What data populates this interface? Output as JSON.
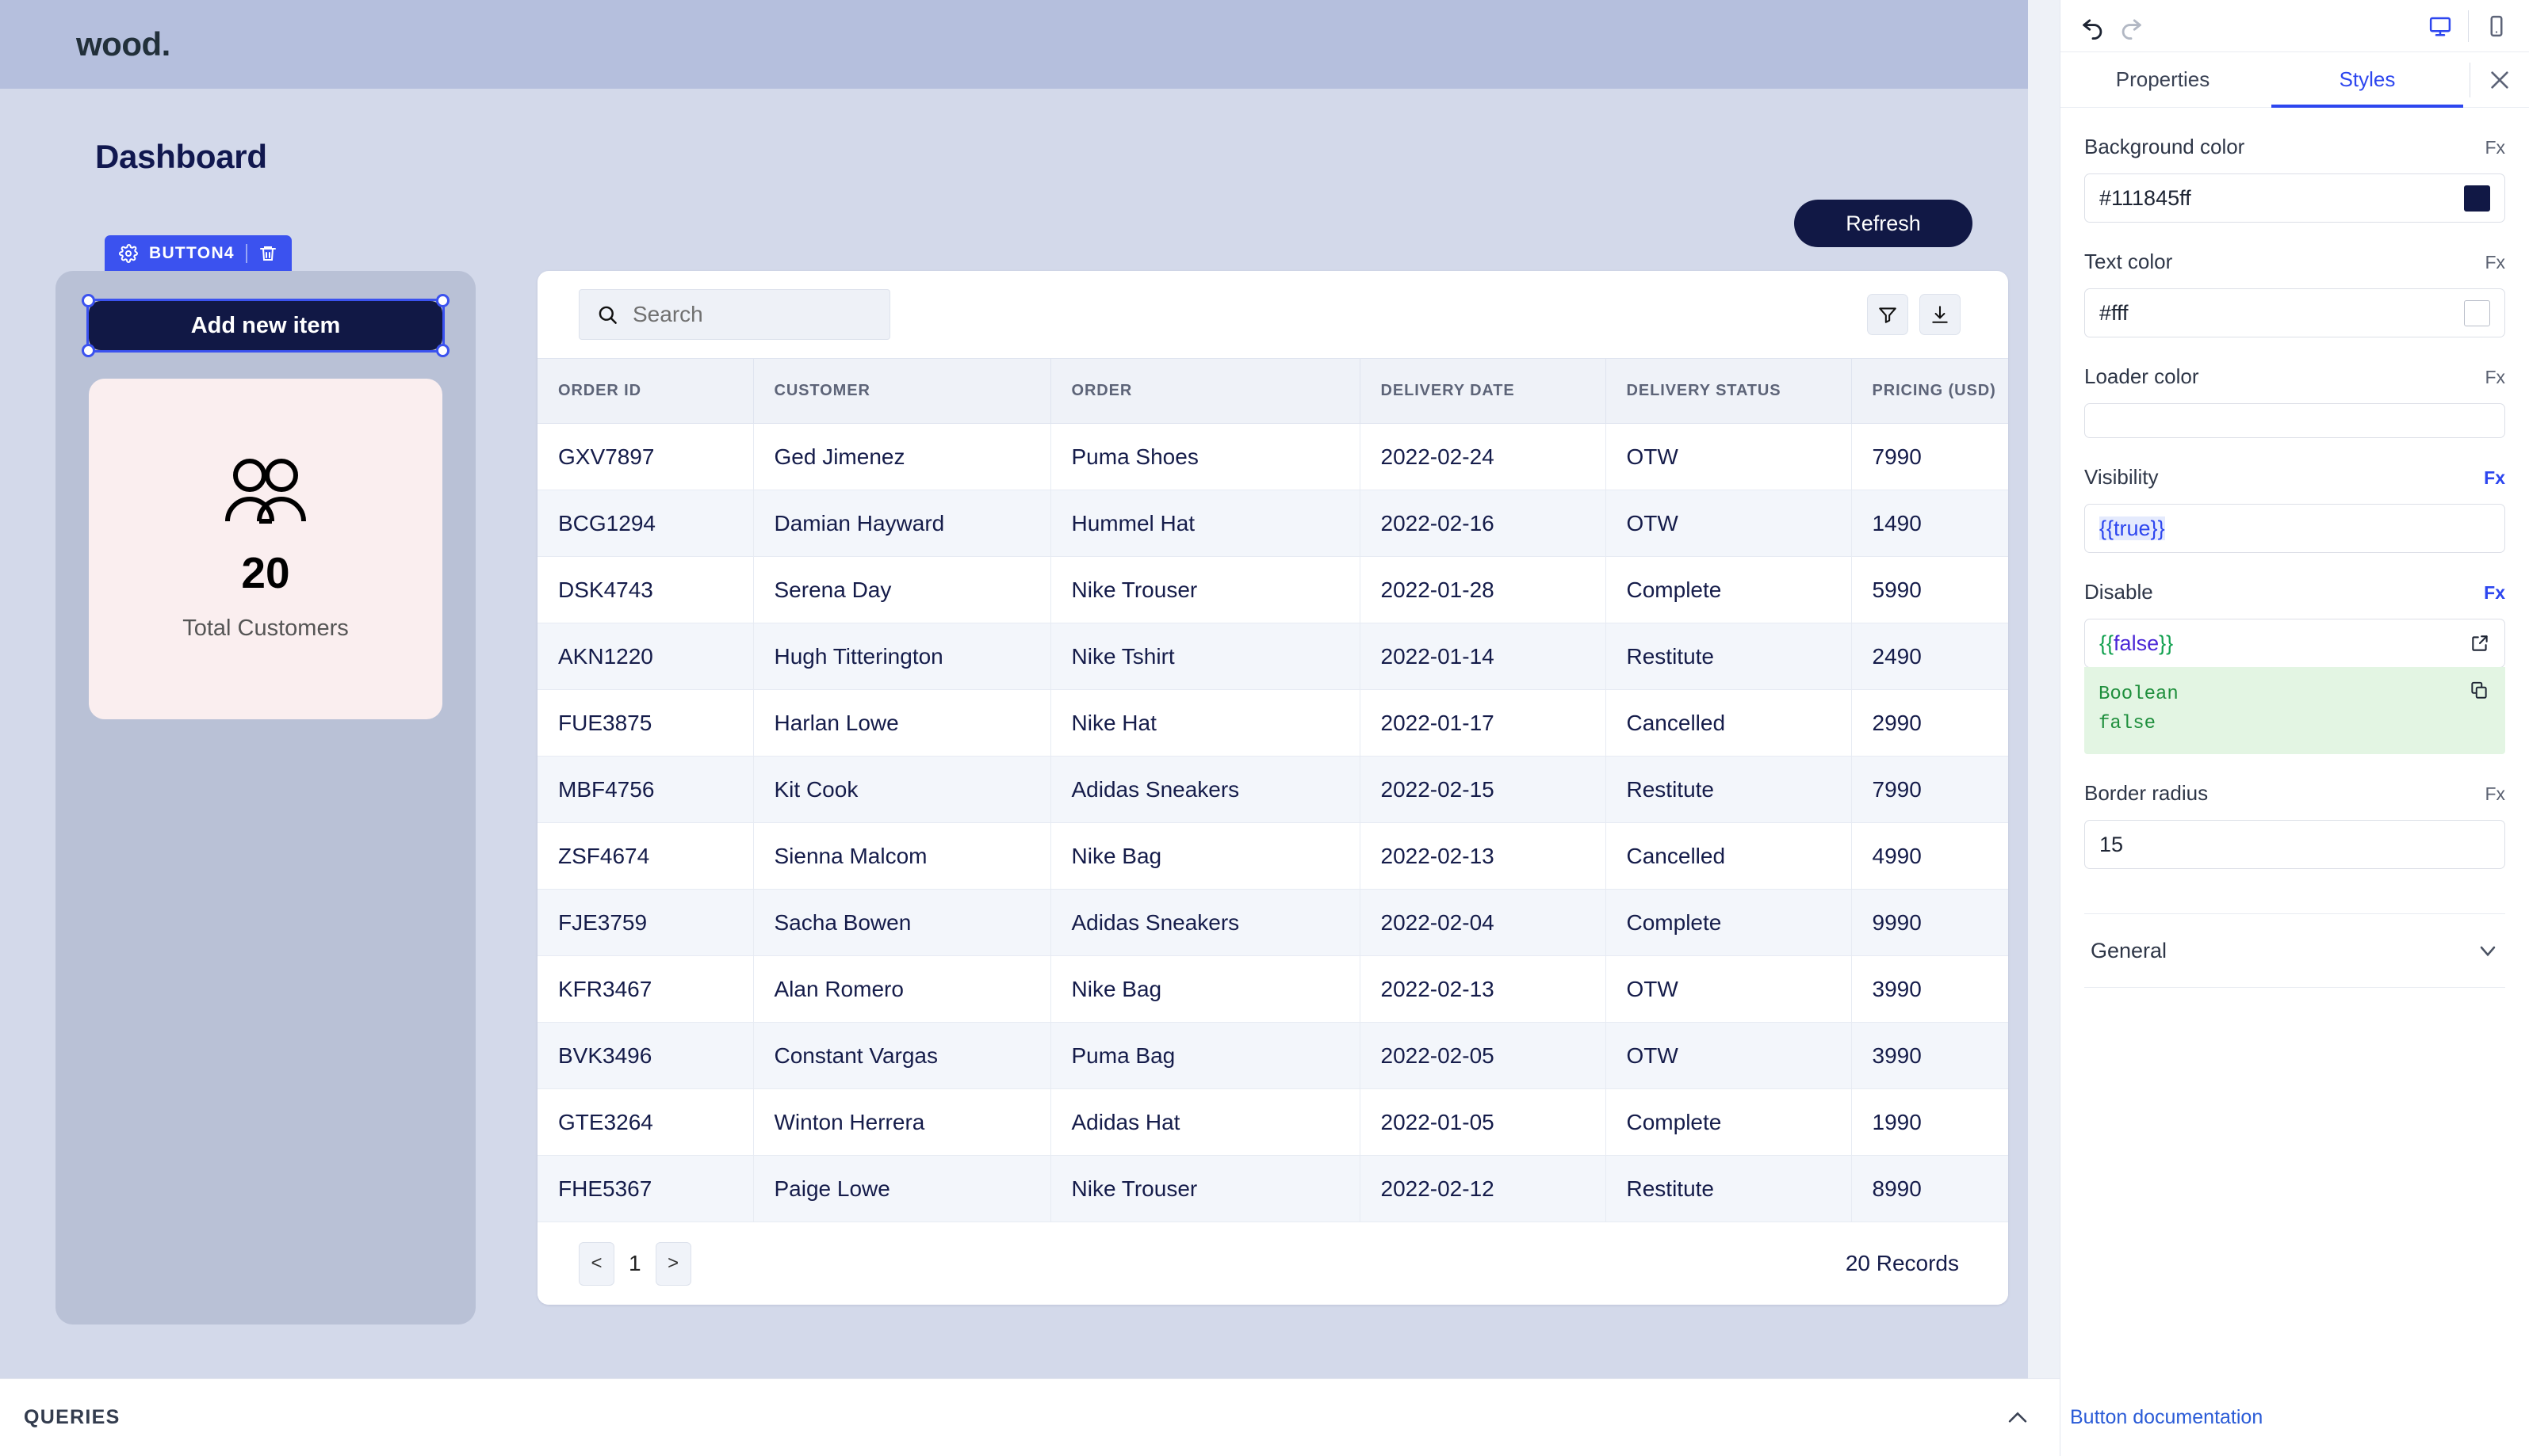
{
  "canvas": {
    "logo": "wood.",
    "page_title": "Dashboard",
    "refresh_label": "Refresh",
    "selection": {
      "badge_label": "BUTTON4",
      "gear_icon": "gear-icon",
      "trash_icon": "trash-icon"
    },
    "add_item_label": "Add new item",
    "stat_card": {
      "icon": "users-icon",
      "value": "20",
      "label": "Total Customers"
    },
    "table": {
      "search_placeholder": "Search",
      "search_value": "",
      "filter_icon": "filter-icon",
      "download_icon": "download-icon",
      "columns": [
        "ORDER ID",
        "CUSTOMER",
        "ORDER",
        "DELIVERY DATE",
        "DELIVERY STATUS",
        "PRICING (USD)"
      ],
      "rows": [
        [
          "GXV7897",
          "Ged Jimenez",
          "Puma Shoes",
          "2022-02-24",
          "OTW",
          "7990"
        ],
        [
          "BCG1294",
          "Damian Hayward",
          "Hummel Hat",
          "2022-02-16",
          "OTW",
          "1490"
        ],
        [
          "DSK4743",
          "Serena Day",
          "Nike Trouser",
          "2022-01-28",
          "Complete",
          "5990"
        ],
        [
          "AKN1220",
          "Hugh Titterington",
          "Nike Tshirt",
          "2022-01-14",
          "Restitute",
          "2490"
        ],
        [
          "FUE3875",
          "Harlan Lowe",
          "Nike Hat",
          "2022-01-17",
          "Cancelled",
          "2990"
        ],
        [
          "MBF4756",
          "Kit Cook",
          "Adidas Sneakers",
          "2022-02-15",
          "Restitute",
          "7990"
        ],
        [
          "ZSF4674",
          "Sienna Malcom",
          "Nike Bag",
          "2022-02-13",
          "Cancelled",
          "4990"
        ],
        [
          "FJE3759",
          "Sacha Bowen",
          "Adidas Sneakers",
          "2022-02-04",
          "Complete",
          "9990"
        ],
        [
          "KFR3467",
          "Alan Romero",
          "Nike Bag",
          "2022-02-13",
          "OTW",
          "3990"
        ],
        [
          "BVK3496",
          "Constant Vargas",
          "Puma Bag",
          "2022-02-05",
          "OTW",
          "3990"
        ],
        [
          "GTE3264",
          "Winton Herrera",
          "Adidas Hat",
          "2022-01-05",
          "Complete",
          "1990"
        ],
        [
          "FHE5367",
          "Paige Lowe",
          "Nike Trouser",
          "2022-02-12",
          "Restitute",
          "8990"
        ]
      ],
      "pagination": {
        "prev": "<",
        "current_page": "1",
        "next": ">",
        "records_text": "20 Records"
      }
    },
    "queries_label": "QUERIES",
    "queries_collapse_icon": "chevron-up-icon"
  },
  "inspector": {
    "undo_icon": "undo-icon",
    "redo_icon": "redo-icon",
    "desktop_icon": "desktop-icon",
    "mobile_icon": "mobile-icon",
    "close_icon": "close-icon",
    "tabs": [
      {
        "label": "Properties",
        "active": false
      },
      {
        "label": "Styles",
        "active": true
      }
    ],
    "fx_label": "Fx",
    "fields": [
      {
        "label": "Background color",
        "value": "#111845ff",
        "swatch": "#111845",
        "fx_active": false
      },
      {
        "label": "Text color",
        "value": "#fff",
        "swatch": "#ffffff",
        "fx_active": false
      },
      {
        "label": "Loader color",
        "value": "",
        "fx_active": false
      },
      {
        "label": "Visibility",
        "value": "{{true}}",
        "fx_active": true
      },
      {
        "label": "Disable",
        "value": "{{false}}",
        "fx_active": true,
        "popout_icon": "external-link-icon",
        "result": {
          "type_line": "Boolean",
          "value_line": "false",
          "copy_icon": "copy-icon"
        }
      },
      {
        "label": "Border radius",
        "value": "15",
        "fx_active": false
      }
    ],
    "general_section_label": "General",
    "general_chevron_icon": "chevron-down-icon",
    "doc_link": "Button documentation"
  },
  "colors": {
    "accent_blue": "#2d46ef",
    "dark_navy": "#111845",
    "canvas_bg": "#d3d9ea",
    "topbar_bg": "#b5bfdd",
    "stat_card_bg": "#faeeef"
  }
}
